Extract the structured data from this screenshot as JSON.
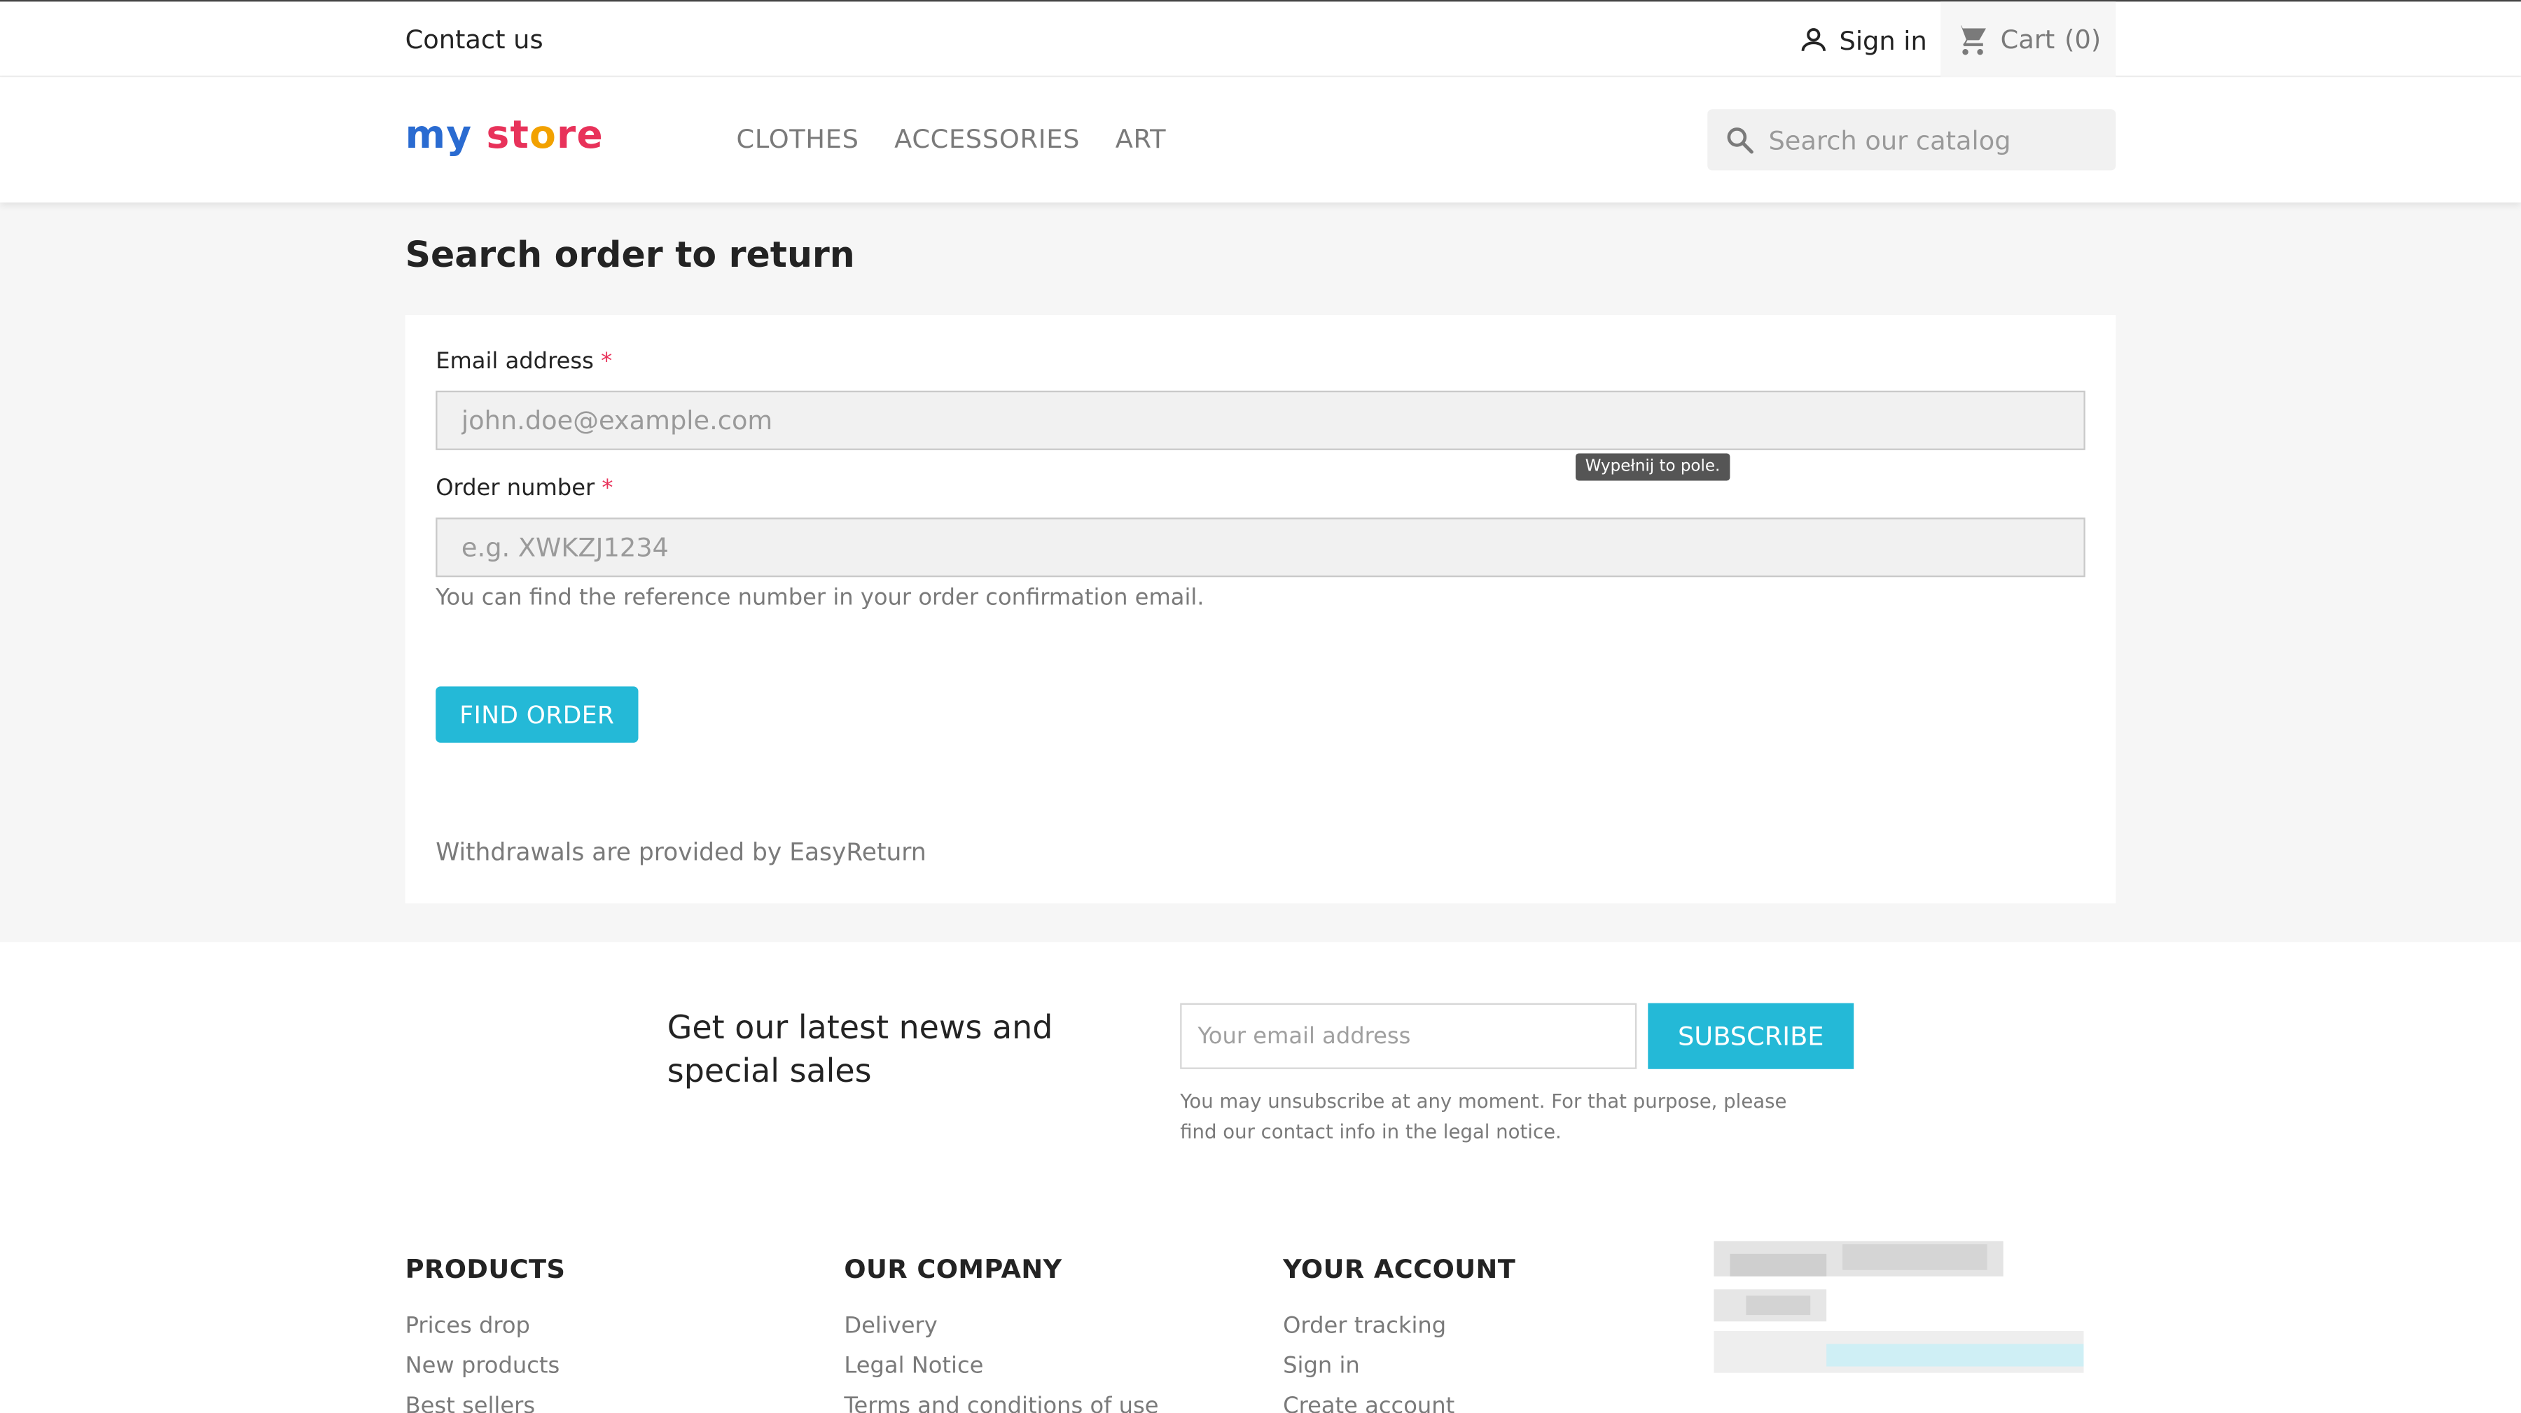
{
  "topnav": {
    "contact": "Contact us",
    "signin": "Sign in",
    "cart": "Cart",
    "cart_count": "(0)"
  },
  "header": {
    "logo": {
      "p1": "my",
      "p2": "st",
      "p3": "o",
      "p4": "re"
    },
    "menu": [
      "CLOTHES",
      "ACCESSORIES",
      "ART"
    ],
    "search_placeholder": "Search our catalog"
  },
  "main": {
    "title": "Search order to return",
    "email_label": "Email address",
    "email_placeholder": "john.doe@example.com",
    "tooltip": "Wypełnij to pole.",
    "order_label": "Order number",
    "order_placeholder": "e.g. XWKZJ1234",
    "help": "You can find the reference number in your order confirmation email.",
    "find_button": "FIND ORDER",
    "provided": "Withdrawals are provided by EasyReturn",
    "required_mark": "*"
  },
  "newsletter": {
    "title": "Get our latest news and special sales",
    "input_placeholder": "Your email address",
    "button": "SUBSCRIBE",
    "note": "You may unsubscribe at any moment. For that purpose, please find our contact info in the legal notice."
  },
  "footer": {
    "products": {
      "title": "PRODUCTS",
      "links": [
        "Prices drop",
        "New products",
        "Best sellers"
      ]
    },
    "company": {
      "title": "OUR COMPANY",
      "links": [
        "Delivery",
        "Legal Notice",
        "Terms and conditions of use"
      ]
    },
    "account": {
      "title": "YOUR ACCOUNT",
      "links": [
        "Order tracking",
        "Sign in",
        "Create account"
      ]
    }
  },
  "colors": {
    "accent": "#24b9d7",
    "required": "#e8325a",
    "text": "#232323",
    "muted": "#7a7a7a"
  }
}
